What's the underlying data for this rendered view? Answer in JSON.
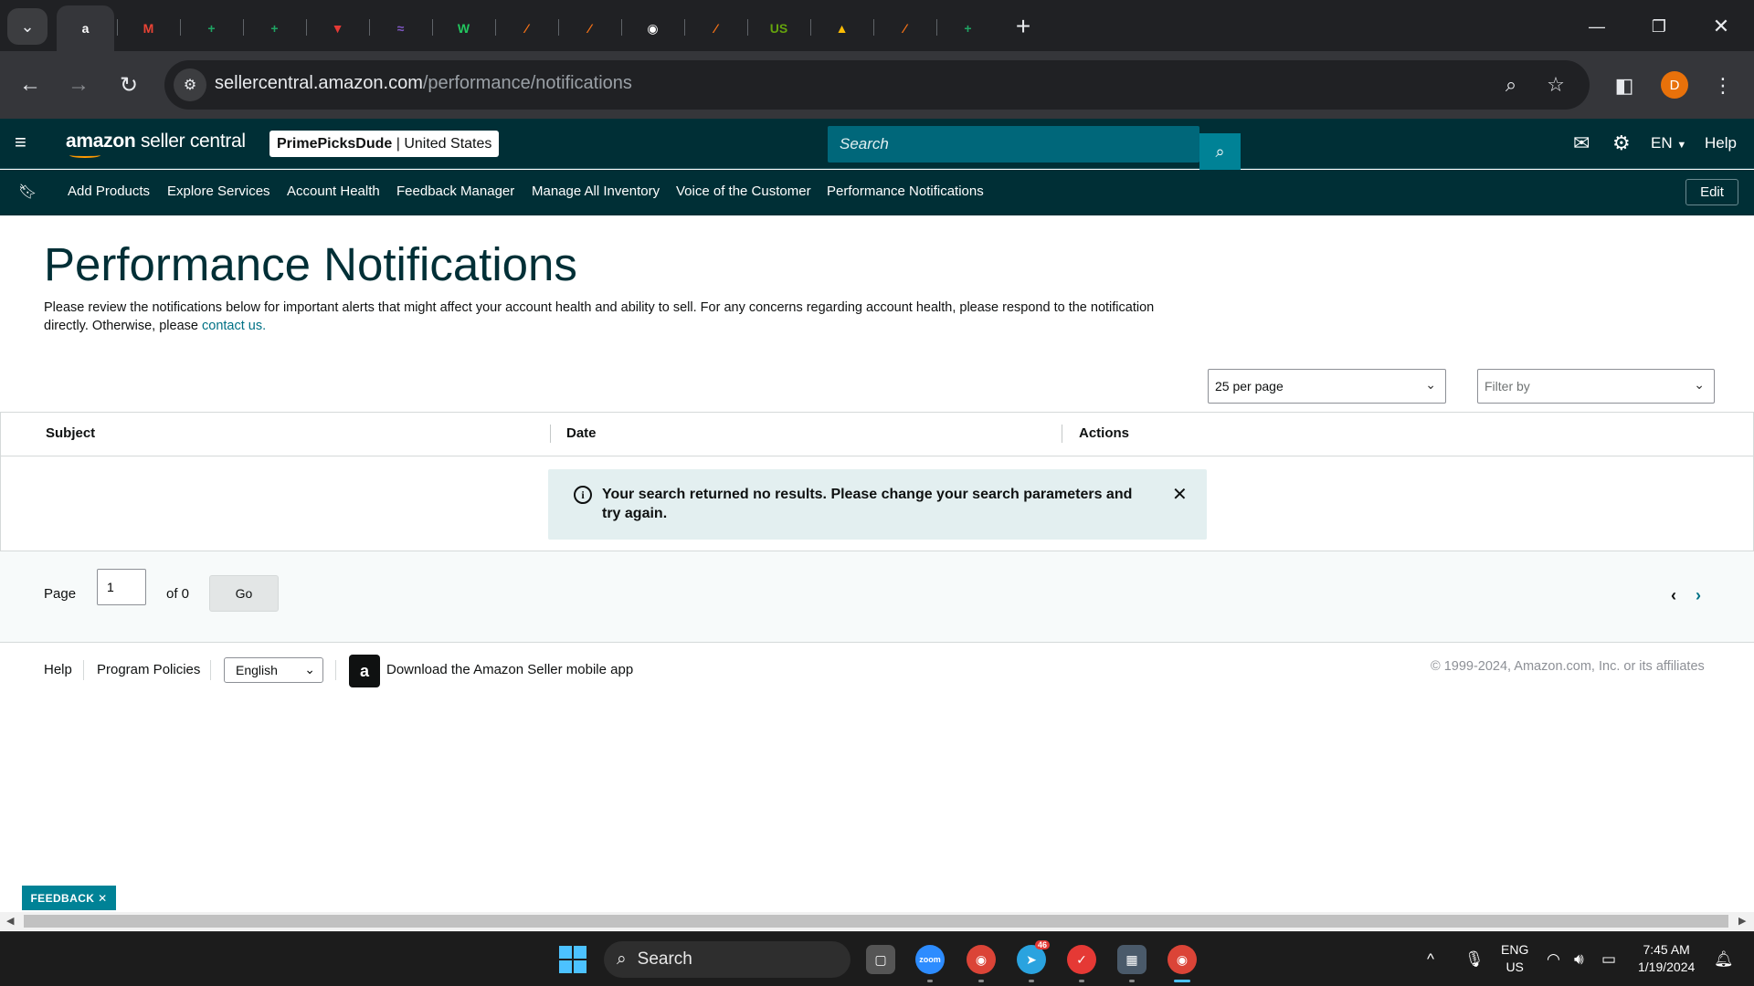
{
  "browser": {
    "url_host": "sellercentral.amazon.com",
    "url_path": "/performance/notifications",
    "profile_initial": "D",
    "new_tab_glyph": "+",
    "tabs": [
      {
        "icon": "amazon-icon",
        "glyph": "a",
        "color": "#ffffff",
        "active": true
      },
      {
        "icon": "gmail-icon",
        "glyph": "M",
        "color": "#ea4335"
      },
      {
        "icon": "sheets-plus-icon",
        "glyph": "+",
        "color": "#1fa463"
      },
      {
        "icon": "sheets-plus-icon",
        "glyph": "+",
        "color": "#1fa463"
      },
      {
        "icon": "red-logo-icon",
        "glyph": "▼",
        "color": "#e53935"
      },
      {
        "icon": "shop-icon",
        "glyph": "≈",
        "color": "#7e57c2"
      },
      {
        "icon": "w-app-icon",
        "glyph": "W",
        "color": "#22c55e"
      },
      {
        "icon": "stripes-icon",
        "glyph": "⁄",
        "color": "#f97316"
      },
      {
        "icon": "stripes-icon",
        "glyph": "⁄",
        "color": "#f97316"
      },
      {
        "icon": "circle-logo-icon",
        "glyph": "◉",
        "color": "#ffffff"
      },
      {
        "icon": "stripes-icon",
        "glyph": "⁄",
        "color": "#f97316"
      },
      {
        "icon": "us-foods-icon",
        "glyph": "US",
        "color": "#65a30d"
      },
      {
        "icon": "drive-icon",
        "glyph": "▲",
        "color": "#fbbc04"
      },
      {
        "icon": "stripes-icon",
        "glyph": "⁄",
        "color": "#f97316"
      },
      {
        "icon": "sheets-plus-icon",
        "glyph": "+",
        "color": "#1fa463"
      }
    ]
  },
  "header": {
    "logo_brand": "amazon",
    "logo_product": "seller central",
    "store_name": "PrimePicksDude",
    "store_region": "United States",
    "search_placeholder": "Search",
    "language": "EN",
    "help": "Help"
  },
  "bookmarks": {
    "items": [
      "Add Products",
      "Explore Services",
      "Account Health",
      "Feedback Manager",
      "Manage All Inventory",
      "Voice of the Customer",
      "Performance Notifications"
    ],
    "edit_label": "Edit"
  },
  "page": {
    "title": "Performance Notifications",
    "description": "Please review the notifications below for important alerts that might affect your account health and ability to sell. For any concerns regarding account health, please respond to the notification directly. Otherwise, please",
    "contact_link": "contact us."
  },
  "filters": {
    "per_page": "25 per page",
    "filter_placeholder": "Filter by"
  },
  "table": {
    "columns": [
      "Subject",
      "Date",
      "Actions"
    ],
    "empty_message": "Your search returned no results. Please change your search parameters and try again."
  },
  "pagination": {
    "page_label": "Page",
    "current_page": "1",
    "of_label": "of 0",
    "go_label": "Go"
  },
  "footer": {
    "help": "Help",
    "program_policies": "Program Policies",
    "language": "English",
    "app_promo": "Download the Amazon Seller mobile app",
    "copyright": "© 1999-2024, Amazon.com, Inc. or its affiliates"
  },
  "feedback_tab": "FEEDBACK",
  "taskbar": {
    "search_label": "Search",
    "telegram_badge": "46",
    "lang_top": "ENG",
    "lang_bottom": "US",
    "time": "7:45 AM",
    "date": "1/19/2024"
  }
}
